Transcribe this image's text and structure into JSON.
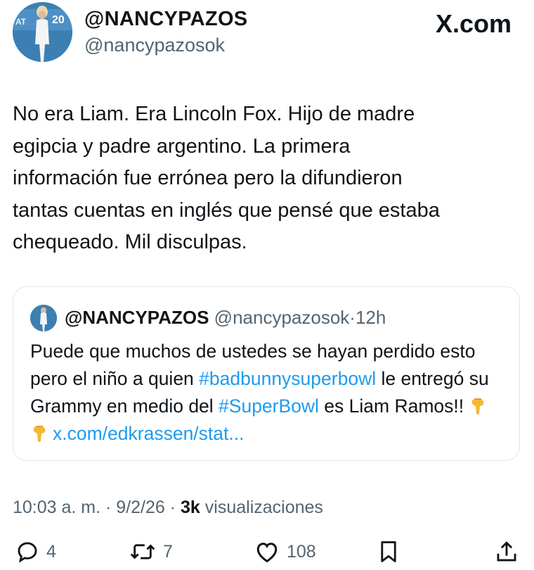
{
  "author": {
    "display_name": "@NANCYPAZOS",
    "handle": "@nancypazosok",
    "avatar_badge": "AT 20"
  },
  "site_label": "X.com",
  "tweet": {
    "text": "No era Liam. Era Lincoln Fox. Hijo de madre\negipcia y padre argentino. La primera\ninformación fue errónea pero la difundieron\ntantas cuentas en inglés que pensé que estaba\nchequeado. Mil disculpas."
  },
  "quoted": {
    "display_name": "@NANCYPAZOS",
    "handle": "@nancypazosok",
    "separator": "·",
    "time": "12h",
    "text_1": "Puede que muchos de ustedes se hayan perdido esto pero el niño a quien ",
    "hashtag_1": "#badbunnysuperbowl",
    "text_2": " le entregó su Grammy en medio del ",
    "hashtag_2": "#SuperBowl",
    "text_3": " es Liam Ramos!! ",
    "emojis": [
      "pointing-down-hand",
      "pointing-down-hand"
    ],
    "link": "x.com/edkrassen/stat..."
  },
  "meta": {
    "time": "10:03 a. m.",
    "sep1": " · ",
    "date": "9/2/26",
    "sep2": " · ",
    "views_count": "3k",
    "views_label": " visualizaciones"
  },
  "actions": {
    "replies": "4",
    "reposts": "7",
    "likes": "108"
  },
  "icons": [
    "reply-icon",
    "repost-icon",
    "like-icon",
    "bookmark-icon",
    "share-icon"
  ],
  "colors": {
    "link": "#1d9bf0",
    "secondary": "#536471",
    "text": "#0f1419"
  }
}
